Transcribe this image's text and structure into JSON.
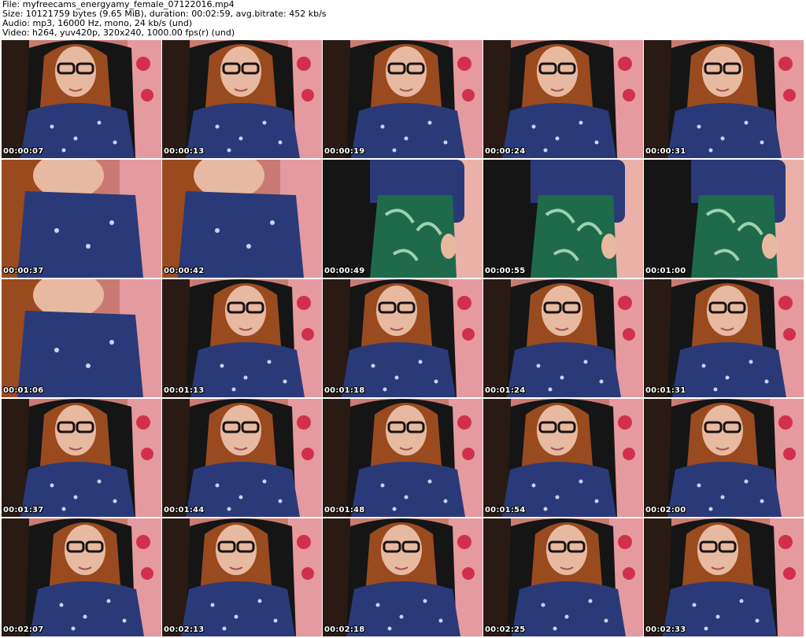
{
  "header": {
    "file_line": "File: myfreecams_energyamy_female_07122016.mp4",
    "size_line": "Size: 10121759 bytes (9.65 MiB), duration: 00:02:59, avg.bitrate: 452 kb/s",
    "audio_line": "Audio: mp3, 16000 Hz, mono, 24 kb/s (und)",
    "video_line": "Video: h264, yuv420p, 320x240, 1000.00 fps(r) (und)"
  },
  "thumbnails": [
    {
      "timestamp": "00:00:07",
      "scene": "portrait-glasses"
    },
    {
      "timestamp": "00:00:13",
      "scene": "portrait-glasses"
    },
    {
      "timestamp": "00:00:19",
      "scene": "portrait-glasses"
    },
    {
      "timestamp": "00:00:24",
      "scene": "portrait-glasses"
    },
    {
      "timestamp": "00:00:31",
      "scene": "portrait-glasses"
    },
    {
      "timestamp": "00:00:37",
      "scene": "leaning-close"
    },
    {
      "timestamp": "00:00:42",
      "scene": "leaning-close"
    },
    {
      "timestamp": "00:00:49",
      "scene": "skirt-closeup"
    },
    {
      "timestamp": "00:00:55",
      "scene": "skirt-closeup"
    },
    {
      "timestamp": "00:01:00",
      "scene": "skirt-closeup"
    },
    {
      "timestamp": "00:01:06",
      "scene": "leaning-close"
    },
    {
      "timestamp": "00:01:13",
      "scene": "portrait-glasses"
    },
    {
      "timestamp": "00:01:18",
      "scene": "portrait-glasses"
    },
    {
      "timestamp": "00:01:24",
      "scene": "portrait-glasses"
    },
    {
      "timestamp": "00:01:31",
      "scene": "portrait-glasses"
    },
    {
      "timestamp": "00:01:37",
      "scene": "portrait-glasses"
    },
    {
      "timestamp": "00:01:44",
      "scene": "portrait-glasses"
    },
    {
      "timestamp": "00:01:48",
      "scene": "portrait-glasses"
    },
    {
      "timestamp": "00:01:54",
      "scene": "portrait-glasses"
    },
    {
      "timestamp": "00:02:00",
      "scene": "portrait-glasses"
    },
    {
      "timestamp": "00:02:07",
      "scene": "portrait-glasses"
    },
    {
      "timestamp": "00:02:13",
      "scene": "portrait-glasses"
    },
    {
      "timestamp": "00:02:18",
      "scene": "portrait-glasses"
    },
    {
      "timestamp": "00:02:25",
      "scene": "portrait-glasses"
    },
    {
      "timestamp": "00:02:33",
      "scene": "portrait-glasses"
    }
  ],
  "colors": {
    "wall": "#c97b73",
    "chair": "#151515",
    "hair": "#9a4a1f",
    "skin": "#e7b9a0",
    "shirt": "#2a3a78",
    "skirt": "#1f6a4a",
    "glasses": "#1a1212"
  }
}
